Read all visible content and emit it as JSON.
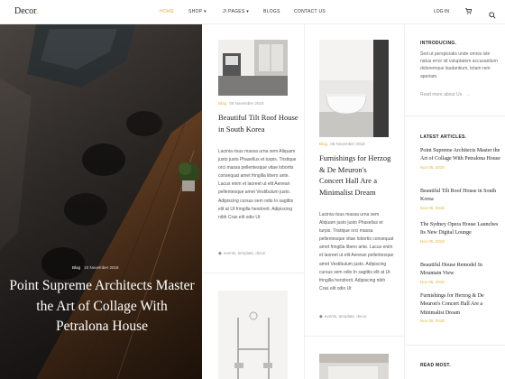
{
  "header": {
    "logo_text": "Decor",
    "logo_dot": ".",
    "nav": [
      "HOME",
      "SHOP ▾",
      "JI PAGES ▾",
      "BLOGS",
      "CONTACT US"
    ],
    "login": "LOG IN"
  },
  "hero": {
    "category": "Blog",
    "date": "10 November 2018",
    "title": "Point Supreme Architects Master the Art of Collage With Petralona House"
  },
  "col1": {
    "post1": {
      "category": "Blog",
      "date": "05 November 2018",
      "title": "Beautiful Tilt Roof House in South Korea",
      "excerpt": "Lacinia risus massa urna sem Aliquam justo justo Phasellus et turpis. Tristique orci massa pellentesque vitae lobortis consequat amet fringilla libero ante. Lacus enim et laoreet ut elit Aenean pellentesque amet Vestibulum justo. Adipiscing cursus sem odio In sagittis elit at Ut fringilla hendrerit. Adipiscing nibh Cras elit odio Ut",
      "tags": "events, template, decor"
    }
  },
  "col2": {
    "post1": {
      "category": "Blog",
      "date": "05 November 2018",
      "title": "Furnishings for Herzog & De Meuron's Concert Hall Are a Minimalist Dream",
      "excerpt": "Lacinia risus massa urna sem Aliquam justo justo Phasellus et turpis. Tristique orci massa pellentesque vitae lobortis consequat amet fringilla libero ante. Lacus enim et laoreet ut elit Aenean pellentesque amet Vestibulum justo. Adipiscing cursus sem odio In sagittis elit at Ut fringilla hendrerit. Adipiscing nibh Cras elit odio Ut",
      "tags": "events, template, decor"
    }
  },
  "sidebar": {
    "intro_heading": "INTRODUCING.",
    "intro_text": "Sed ut perspiciatis unde omnis iste natus error sit voluptatem accusantium doloremque laudantium, totam rem aperiam.",
    "read_more": "Read more about Us",
    "latest_heading": "LATEST ARTICLES.",
    "latest": [
      {
        "title": "Point Supreme Architects Master the Art of Collage With Petralona House",
        "date": "Nov 05, 2018"
      },
      {
        "title": "Beautiful Tilt Roof House in South Korea",
        "date": "Nov 05, 2018"
      },
      {
        "title": "The Sydney Opera House Launches Its New Digital Lounge",
        "date": "Nov 05, 2018"
      },
      {
        "title": "Beautiful House Remodel In Mountain View",
        "date": "Nov 05, 2018"
      },
      {
        "title": "Furnishings for Herzog & De Meuron's Concert Hall Are a Minimalist Dream",
        "date": "Nov 05, 2018"
      }
    ],
    "most_read_heading": "READ MOST."
  },
  "colors": {
    "accent": "#e2b33a",
    "text": "#222222",
    "muted": "#999999"
  }
}
